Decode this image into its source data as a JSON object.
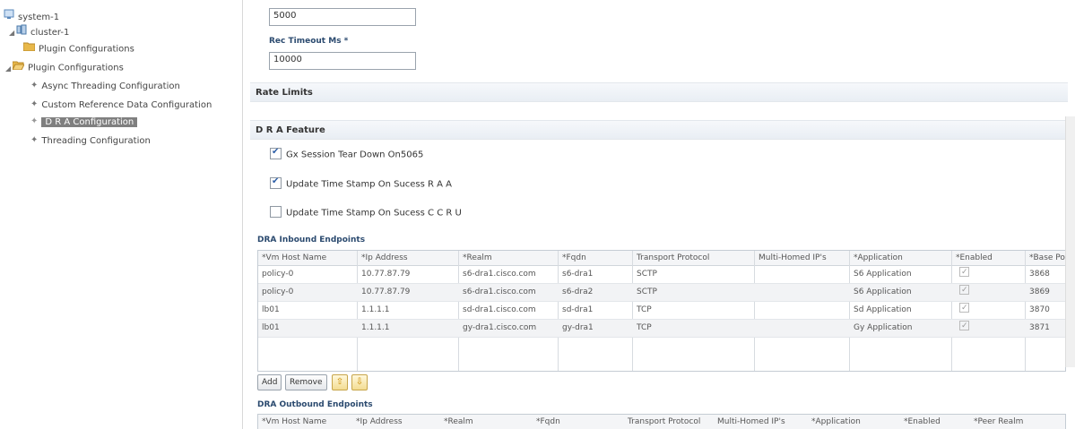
{
  "tree": {
    "items": [
      {
        "label": "system-1",
        "icon": "system-icon",
        "level": 0
      },
      {
        "label": "cluster-1",
        "icon": "cluster-icon",
        "level": 1
      },
      {
        "label": "Plugin Configurations",
        "icon": "folder-icon",
        "level": 2
      },
      {
        "label": "Plugin Configurations",
        "icon": "folder-open-icon",
        "level": 1
      },
      {
        "label": "Async Threading Configuration",
        "icon": "config-icon",
        "level": 2
      },
      {
        "label": "Custom Reference Data Configuration",
        "icon": "config-icon",
        "level": 2
      },
      {
        "label": "D R A Configuration",
        "icon": "config-icon",
        "level": 2,
        "selected": true
      },
      {
        "label": "Threading Configuration",
        "icon": "config-icon",
        "level": 2
      }
    ]
  },
  "form": {
    "top_value": "5000",
    "rec_timeout_label": "Rec Timeout Ms *",
    "rec_timeout_value": "10000"
  },
  "sections": {
    "rate_limits": "Rate Limits",
    "dra_feature": "D R A Feature"
  },
  "checkboxes": [
    {
      "label": "Gx Session Tear Down On5065",
      "checked": true
    },
    {
      "label": "Update Time Stamp On Sucess R A A",
      "checked": true
    },
    {
      "label": "Update Time Stamp On Sucess C C R U",
      "checked": false
    }
  ],
  "inbound": {
    "title": "DRA Inbound Endpoints",
    "headers": [
      "*Vm Host Name",
      "*Ip Address",
      "*Realm",
      "*Fqdn",
      "Transport Protocol",
      "Multi-Homed IP's",
      "*Application",
      "*Enabled",
      "*Base Po"
    ],
    "rows": [
      [
        "policy-0",
        "10.77.87.79",
        "s6-dra1.cisco.com",
        "s6-dra1",
        "SCTP",
        "",
        "S6 Application",
        "",
        "3868"
      ],
      [
        "policy-0",
        "10.77.87.79",
        "s6-dra1.cisco.com",
        "s6-dra2",
        "SCTP",
        "",
        "S6 Application",
        "",
        "3869"
      ],
      [
        "lb01",
        "1.1.1.1",
        "sd-dra1.cisco.com",
        "sd-dra1",
        "TCP",
        "",
        "Sd Application",
        "",
        "3870"
      ],
      [
        "lb01",
        "1.1.1.1",
        "gy-dra1.cisco.com",
        "gy-dra1",
        "TCP",
        "",
        "Gy Application",
        "",
        "3871"
      ]
    ]
  },
  "buttons": {
    "add": "Add",
    "remove": "Remove",
    "up_icon": "arrow-up-icon",
    "down_icon": "arrow-down-icon"
  },
  "outbound": {
    "title": "DRA Outbound Endpoints",
    "headers": [
      "*Vm Host Name",
      "*Ip Address",
      "*Realm",
      "*Fqdn",
      "Transport Protocol",
      "Multi-Homed IP's",
      "*Application",
      "*Enabled",
      "*Peer Realm"
    ]
  },
  "colors": {
    "selection": "#7f7f7f",
    "label_blue": "#2b4a6f",
    "folder": "#e8b84a"
  }
}
